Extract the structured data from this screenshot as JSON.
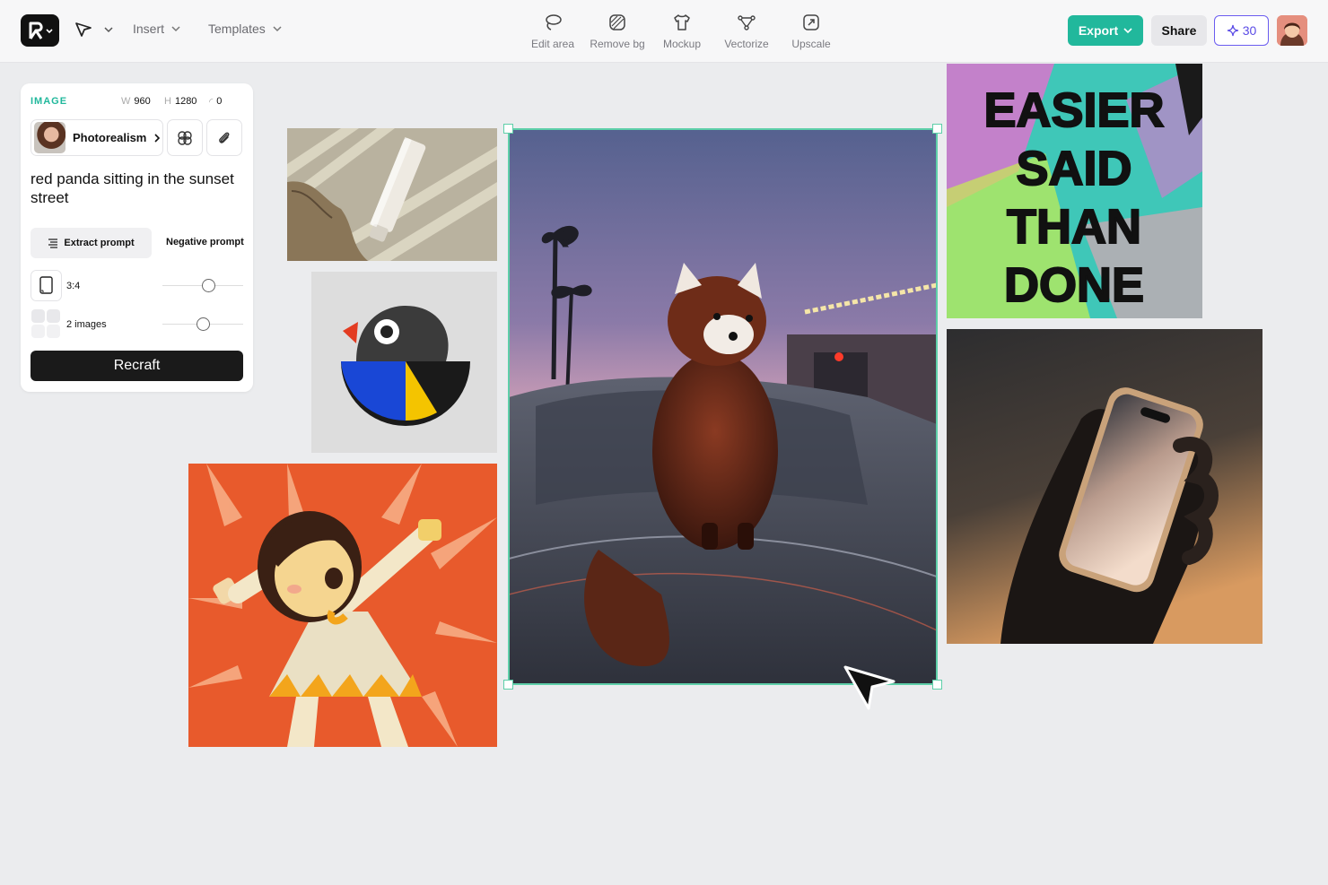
{
  "toolbar": {
    "insert_label": "Insert",
    "templates_label": "Templates",
    "tools": [
      {
        "label": "Edit area",
        "icon": "lasso-icon"
      },
      {
        "label": "Remove bg",
        "icon": "remove-bg-icon"
      },
      {
        "label": "Mockup",
        "icon": "tshirt-icon"
      },
      {
        "label": "Vectorize",
        "icon": "vector-nodes-icon"
      },
      {
        "label": "Upscale",
        "icon": "upscale-icon"
      }
    ],
    "export_label": "Export",
    "share_label": "Share",
    "credits": "30"
  },
  "panel": {
    "section_label": "IMAGE",
    "width_key": "W",
    "width_value": "960",
    "height_key": "H",
    "height_value": "1280",
    "rotation_value": "0",
    "style_label": "Photorealism",
    "prompt": "red panda sitting in the sunset street",
    "extract_label": "Extract prompt",
    "negative_label": "Negative prompt",
    "aspect_label": "3:4",
    "aspect_slider": 0.58,
    "count_label": "2 images",
    "count_slider": 0.5,
    "recraft_label": "Recraft"
  },
  "canvas": {
    "selected_image": "red panda on car at sunset",
    "poster_text": [
      "EASIER",
      "SAID",
      "THAN",
      "DONE"
    ]
  },
  "colors": {
    "accent": "#21b89c",
    "credits": "#5b4ce6",
    "orange": "#e85a2c"
  }
}
